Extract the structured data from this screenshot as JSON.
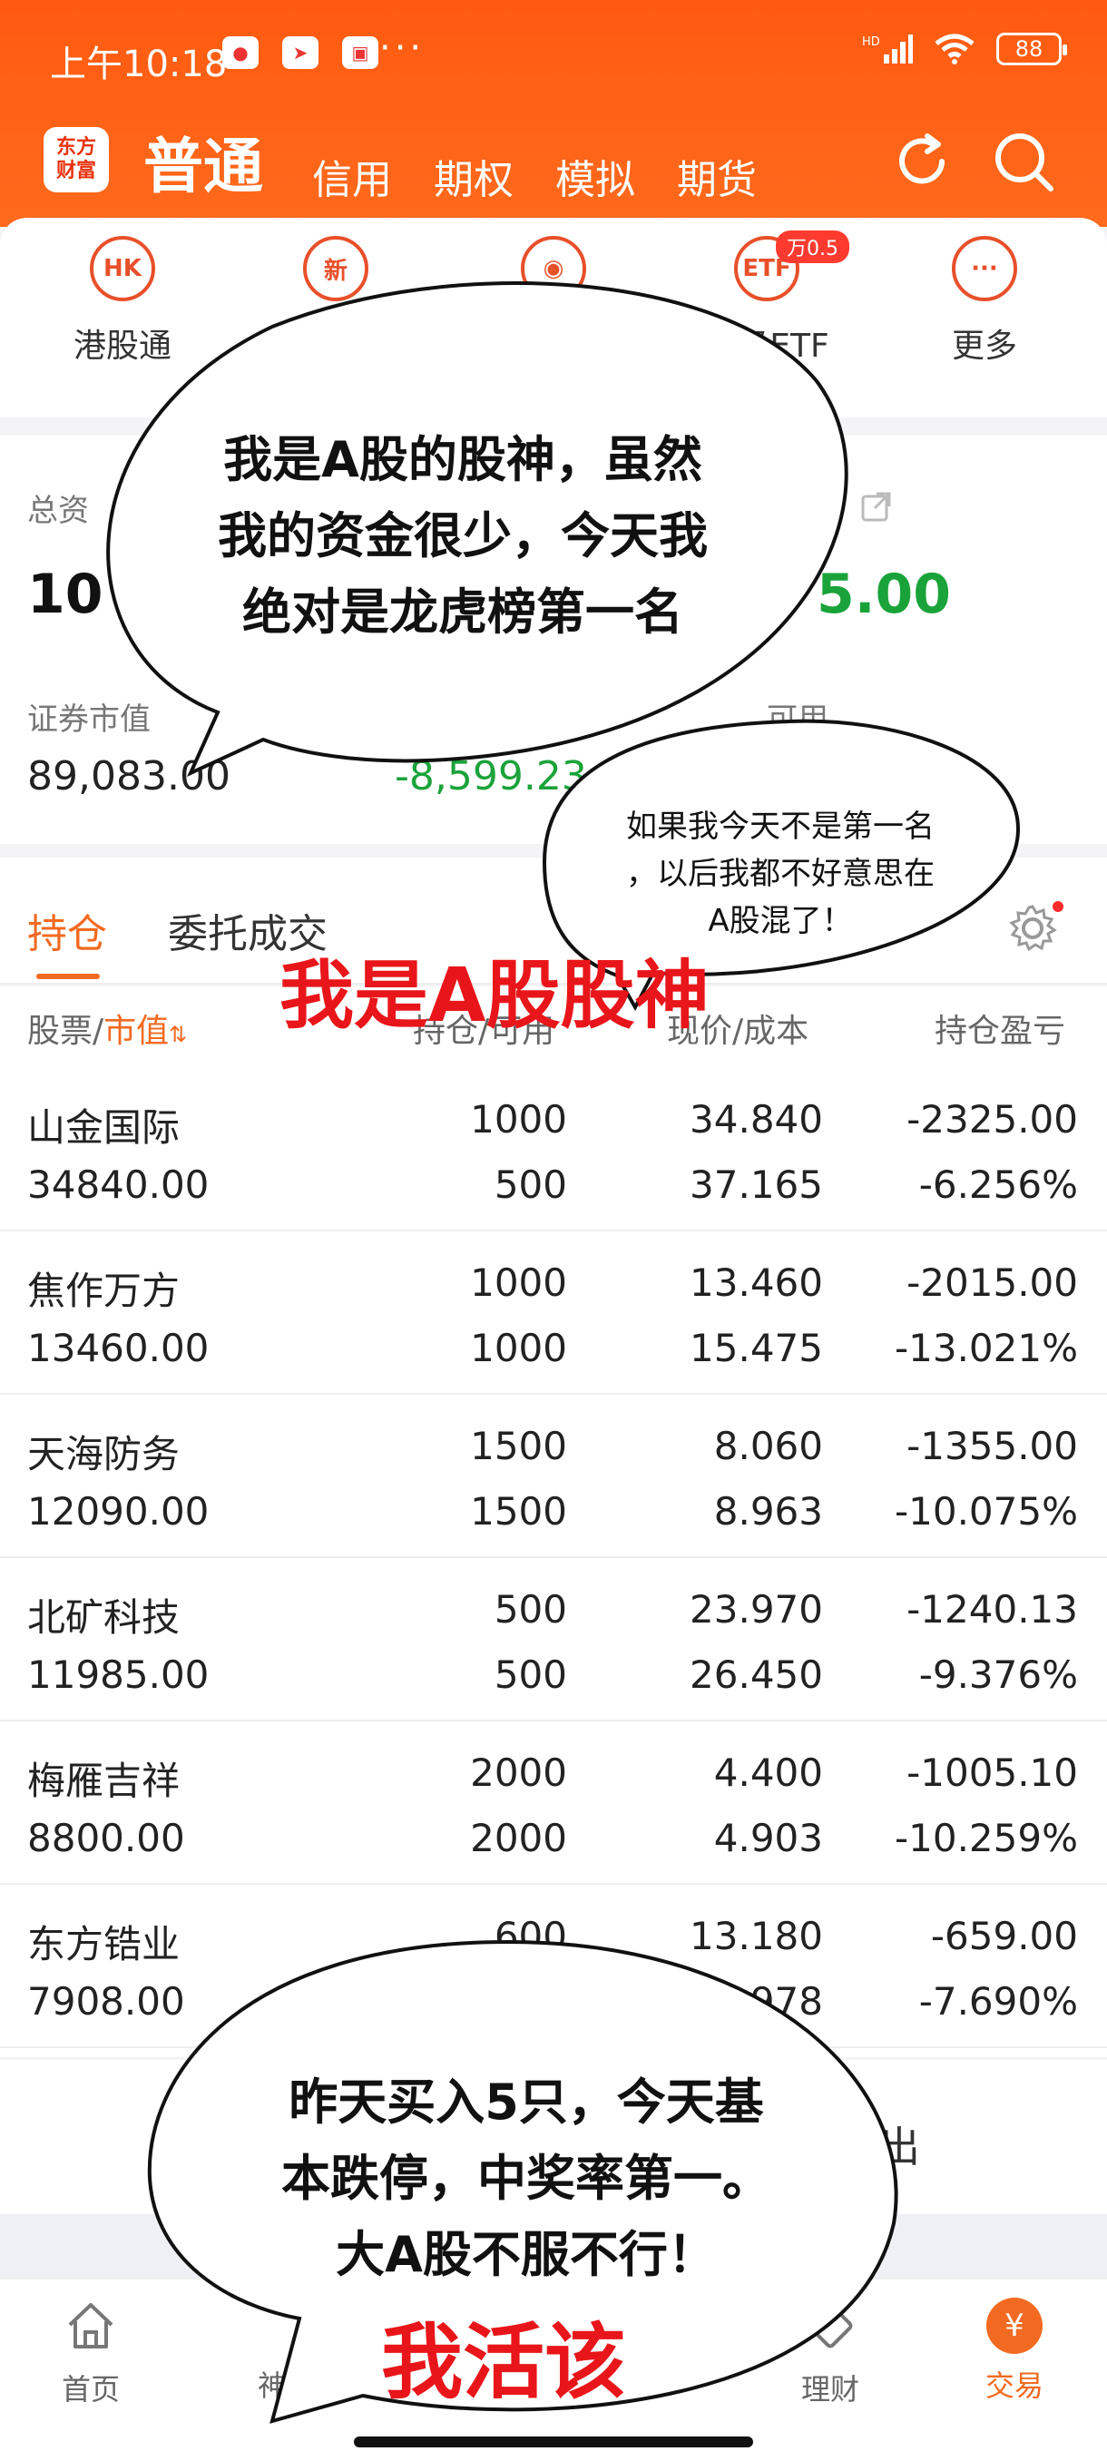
{
  "status_bar": {
    "time": "上午10:18",
    "dots": "···",
    "battery": "88",
    "app_icons": [
      "app-red-icon",
      "app-paper-plane-icon",
      "app-bag-icon"
    ]
  },
  "header": {
    "logo_line1": "东方",
    "logo_line2": "财富",
    "tabs": [
      {
        "label": "普通",
        "active": true
      },
      {
        "label": "信用"
      },
      {
        "label": "期权"
      },
      {
        "label": "模拟"
      },
      {
        "label": "期货"
      }
    ]
  },
  "shortcuts": [
    {
      "label": "港股通",
      "icon": "HK"
    },
    {
      "label": "",
      "icon": "新"
    },
    {
      "label": "",
      "icon": "piggy"
    },
    {
      "label": "超级ETF",
      "icon": "ETF",
      "badge": "万0.5"
    },
    {
      "label": "更多",
      "icon": "···"
    }
  ],
  "assets": {
    "total_label": "总资",
    "total_value": "10",
    "pnl_value": "5.00",
    "market_value_label": "证券市值",
    "market_value": "89,083.00",
    "daily_pnl": "-8,599.23",
    "available_label": "可用"
  },
  "position_tabs": [
    {
      "label": "持仓",
      "active": true
    },
    {
      "label": "委托成交"
    }
  ],
  "columns": {
    "stock": "股票/",
    "market_value": "市值",
    "holdings": "持仓/可用",
    "price": "现价/成本",
    "pnl": "持仓盈亏"
  },
  "holdings": [
    {
      "name": "山金国际",
      "value": "34840.00",
      "qty": "1000",
      "avail": "500",
      "price": "34.840",
      "cost": "37.165",
      "pnl": "-2325.00",
      "pnl_pct": "-6.256%"
    },
    {
      "name": "焦作万方",
      "value": "13460.00",
      "qty": "1000",
      "avail": "1000",
      "price": "13.460",
      "cost": "15.475",
      "pnl": "-2015.00",
      "pnl_pct": "-13.021%"
    },
    {
      "name": "天海防务",
      "value": "12090.00",
      "qty": "1500",
      "avail": "1500",
      "price": "8.060",
      "cost": "8.963",
      "pnl": "-1355.00",
      "pnl_pct": "-10.075%"
    },
    {
      "name": "北矿科技",
      "value": "11985.00",
      "qty": "500",
      "avail": "500",
      "price": "23.970",
      "cost": "26.450",
      "pnl": "-1240.13",
      "pnl_pct": "-9.376%"
    },
    {
      "name": "梅雁吉祥",
      "value": "8800.00",
      "qty": "2000",
      "avail": "2000",
      "price": "4.400",
      "cost": "4.903",
      "pnl": "-1005.10",
      "pnl_pct": "-10.259%"
    },
    {
      "name": "东方锆业",
      "value": "7908.00",
      "qty": "600",
      "avail": "",
      "price": "13.180",
      "cost": "978",
      "pnl": "-659.00",
      "pnl_pct": "-7.690%"
    }
  ],
  "footer_partial": "出",
  "bottom_nav": [
    {
      "label": "首页",
      "icon": "home-icon"
    },
    {
      "label": "神",
      "icon": ""
    },
    {
      "label": "",
      "icon": ""
    },
    {
      "label": "理财",
      "icon": "finance-icon"
    },
    {
      "label": "交易",
      "icon": "trade-icon",
      "glyph": "¥",
      "active": true
    }
  ],
  "overlays": {
    "bubble1": [
      "我是A股的股神，虽然",
      "我的资金很少，今天我",
      "绝对是龙虎榜第一名"
    ],
    "bubble2": [
      "如果我今天不是第一名",
      "，以后我都不好意思在",
      "A股混了！"
    ],
    "red_caption1": "我是A股股神",
    "bubble3": [
      "昨天买入5只，今天基",
      "本跌停，中奖率第一。",
      "大A股不服不行！"
    ],
    "red_caption2": "我活该"
  },
  "colors": {
    "brand_orange": "#ff5a10",
    "accent": "#f26a21",
    "loss_green": "#1aa33a",
    "caption_red": "#e8161a"
  }
}
